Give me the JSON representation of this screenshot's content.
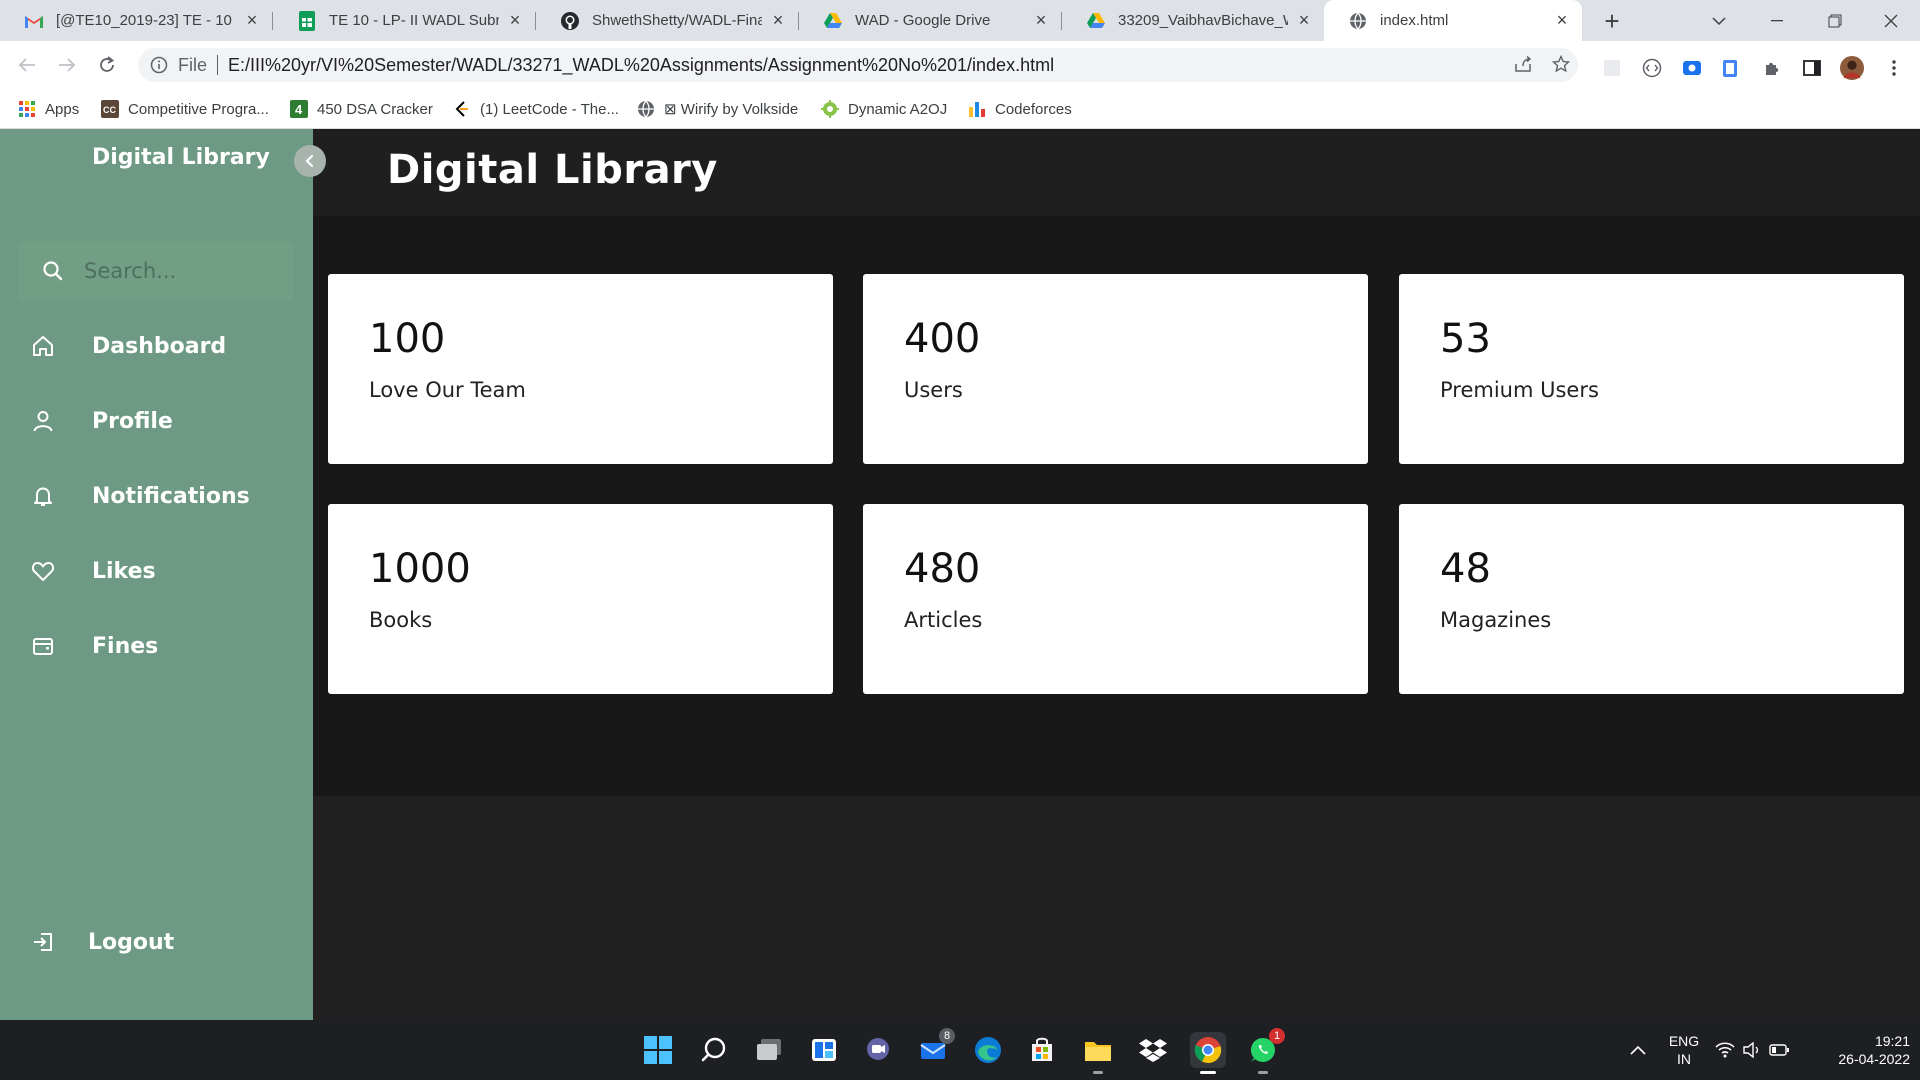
{
  "browser": {
    "tabs": [
      {
        "label": "[@TE10_2019-23] TE - 10 ::",
        "icon": "gmail-icon",
        "active": false
      },
      {
        "label": "TE 10 - LP- II WADL Submis",
        "icon": "sheets-icon",
        "active": false
      },
      {
        "label": "ShwethShetty/WADL-Final",
        "icon": "github-icon",
        "active": false
      },
      {
        "label": "WAD - Google Drive",
        "icon": "drive-icon",
        "active": false
      },
      {
        "label": "33209_VaibhavBichave_WA",
        "icon": "drive-icon",
        "active": false
      },
      {
        "label": "index.html",
        "icon": "globe-icon",
        "active": true
      }
    ],
    "address": {
      "scheme": "File",
      "url": "E:/III%20yr/VI%20Semester/WADL/33271_WADL%20Assignments/Assignment%20No%201/index.html"
    },
    "bookmarks": [
      {
        "label": "Apps",
        "icon": "apps-grid-icon"
      },
      {
        "label": "Competitive Progra...",
        "icon": "cc-icon"
      },
      {
        "label": "450 DSA Cracker",
        "icon": "number-four-icon"
      },
      {
        "label": "(1) LeetCode - The...",
        "icon": "leetcode-icon"
      },
      {
        "label": "⊠ Wirify by Volkside",
        "icon": "globe-icon"
      },
      {
        "label": "Dynamic A2OJ",
        "icon": "a2oj-icon"
      },
      {
        "label": "Codeforces",
        "icon": "codeforces-icon"
      }
    ]
  },
  "sidebar": {
    "brand": "Digital Library",
    "search_placeholder": "Search...",
    "items": [
      {
        "label": "Dashboard",
        "icon": "home-icon"
      },
      {
        "label": "Profile",
        "icon": "user-icon"
      },
      {
        "label": "Notifications",
        "icon": "bell-icon"
      },
      {
        "label": "Likes",
        "icon": "heart-icon"
      },
      {
        "label": "Fines",
        "icon": "wallet-icon"
      }
    ],
    "logout": "Logout"
  },
  "main": {
    "title": "Digital Library",
    "cards": [
      {
        "value": "100",
        "label": "Love Our Team"
      },
      {
        "value": "400",
        "label": "Users"
      },
      {
        "value": "53",
        "label": "Premium Users"
      },
      {
        "value": "1000",
        "label": "Books"
      },
      {
        "value": "480",
        "label": "Articles"
      },
      {
        "value": "48",
        "label": "Magazines"
      }
    ]
  },
  "taskbar": {
    "mail_badge": "8",
    "whatsapp_badge": "1",
    "language": "ENG",
    "region": "IN",
    "time": "19:21",
    "date": "26-04-2022"
  },
  "colors": {
    "sidebar": "#6e9a85",
    "page_background": "#1f1f1f",
    "card": "#ffffff"
  }
}
